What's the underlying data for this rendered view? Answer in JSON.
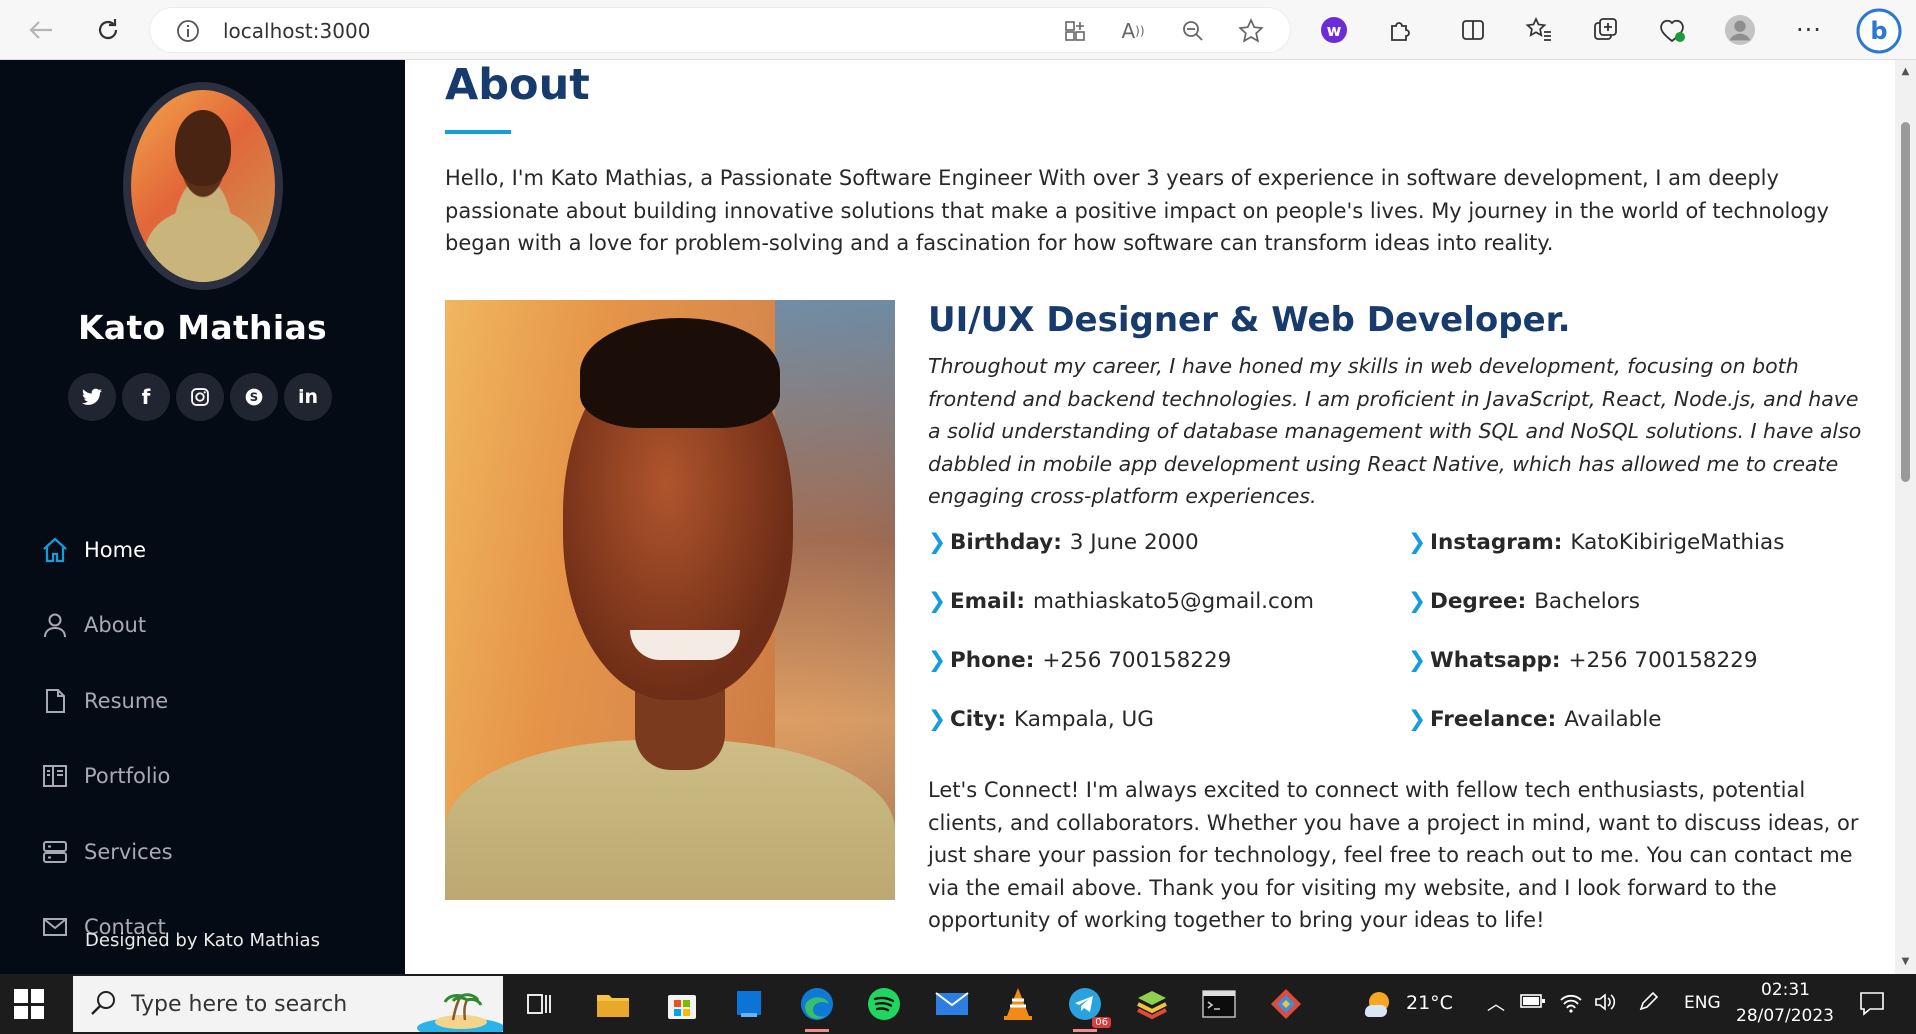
{
  "browser": {
    "url": "localhost:3000"
  },
  "sidebar": {
    "name": "Kato Mathias",
    "socials": [
      "twitter",
      "facebook",
      "instagram",
      "skype",
      "linkedin"
    ],
    "nav": [
      {
        "label": "Home",
        "icon": "home-icon",
        "active": true
      },
      {
        "label": "About",
        "icon": "person-icon",
        "active": false
      },
      {
        "label": "Resume",
        "icon": "file-icon",
        "active": false
      },
      {
        "label": "Portfolio",
        "icon": "book-icon",
        "active": false
      },
      {
        "label": "Services",
        "icon": "server-icon",
        "active": false
      },
      {
        "label": "Contact",
        "icon": "envelope-icon",
        "active": false
      }
    ],
    "footer": "Designed by Kato Mathias"
  },
  "about": {
    "title": "About",
    "intro": "Hello, I'm Kato Mathias, a Passionate Software Engineer With over 3 years of experience in software development, I am deeply passionate about building innovative solutions that make a positive impact on people's lives. My journey in the world of technology began with a love for problem-solving and a fascination for how software can transform ideas into reality.",
    "role_title": "UI/UX Designer & Web Developer.",
    "role_desc": "Throughout my career, I have honed my skills in web development, focusing on both frontend and backend technologies. I am proficient in JavaScript, React, Node.js, and have a solid understanding of database management with SQL and NoSQL solutions. I have also dabbled in mobile app development using React Native, which has allowed me to create engaging cross-platform experiences.",
    "info_left": [
      {
        "label": "Birthday:",
        "value": "3 June 2000"
      },
      {
        "label": "Email:",
        "value": "mathiaskato5@gmail.com"
      },
      {
        "label": "Phone:",
        "value": "+256 700158229"
      },
      {
        "label": "City:",
        "value": "Kampala, UG"
      }
    ],
    "info_right": [
      {
        "label": "Instagram:",
        "value": "KatoKibirigeMathias"
      },
      {
        "label": "Degree:",
        "value": "Bachelors"
      },
      {
        "label": "Whatsapp:",
        "value": "+256 700158229"
      },
      {
        "label": "Freelance:",
        "value": "Available"
      }
    ],
    "outro": "Let's Connect! I'm always excited to connect with fellow tech enthusiasts, potential clients, and collaborators. Whether you have a project in mind, want to discuss ideas, or just share your passion for technology, feel free to reach out to me. You can contact me via the email above. Thank you for visiting my website, and I look forward to the opportunity of working together to bring your ideas to life!"
  },
  "taskbar": {
    "search_placeholder": "Type here to search",
    "weather": "21°C",
    "language": "ENG",
    "time": "02:31",
    "date": "28/07/2023",
    "telegram_badge": "06"
  },
  "colors": {
    "sidebar_bg": "#040b14",
    "accent": "#149ddd",
    "heading": "#173b6c"
  }
}
